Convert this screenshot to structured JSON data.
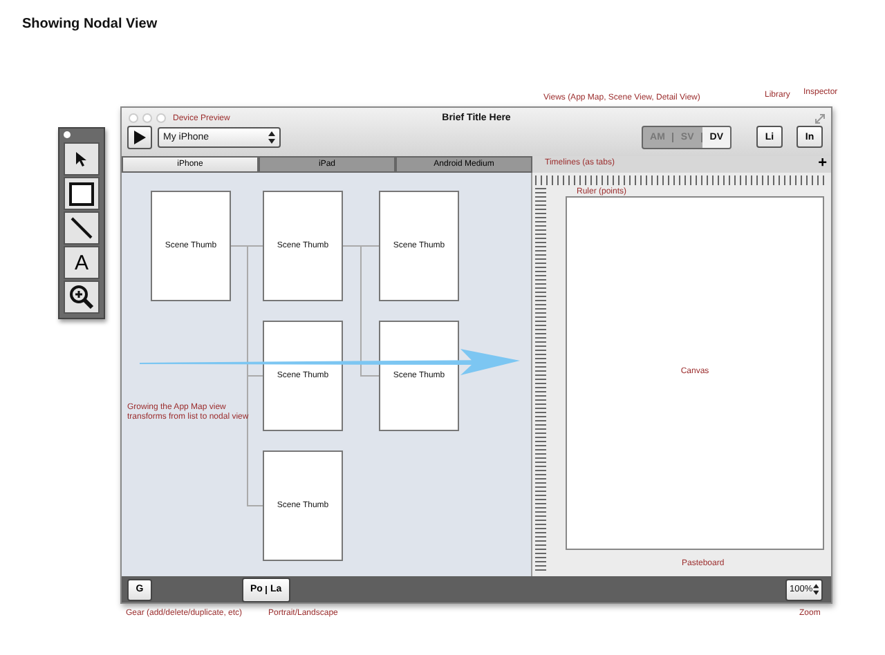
{
  "page_title": "Showing Nodal View",
  "annotations": {
    "device_preview": "Device Preview",
    "views": "Views (App Map, Scene View, Detail View)",
    "library": "Library",
    "inspector": "Inspector",
    "timelines": "Timelines (as tabs)",
    "ruler": "Ruler (points)",
    "canvas": "Canvas",
    "growing": "Growing the App Map view transforms from list to nodal view",
    "pasteboard": "Pasteboard",
    "gear": "Gear (add/delete/duplicate, etc)",
    "orientation": "Portrait/Landscape",
    "zoom": "Zoom"
  },
  "tool_palette": {
    "tools": [
      {
        "kind": "select"
      },
      {
        "kind": "rectangle"
      },
      {
        "kind": "line"
      },
      {
        "kind": "text",
        "label": "A"
      },
      {
        "kind": "zoom"
      }
    ]
  },
  "window": {
    "title": "Brief Title Here",
    "device_select": {
      "value": "My iPhone"
    },
    "view_modes": [
      {
        "label": "AM",
        "selected": false
      },
      {
        "label": "SV",
        "selected": false
      },
      {
        "label": "DV",
        "selected": true
      }
    ],
    "panel_buttons": [
      {
        "label": "Li"
      },
      {
        "label": "In"
      }
    ],
    "device_tabs": [
      {
        "label": "iPhone",
        "selected": true
      },
      {
        "label": "iPad",
        "selected": false
      },
      {
        "label": "Android Medium",
        "selected": false
      }
    ],
    "add_timeline": "+"
  },
  "scene_map": {
    "thumbs": [
      {
        "label": "Scene Thumb"
      },
      {
        "label": "Scene Thumb"
      },
      {
        "label": "Scene Thumb"
      },
      {
        "label": "Scene Thumb"
      },
      {
        "label": "Scene Thumb"
      },
      {
        "label": "Scene Thumb"
      }
    ]
  },
  "bottom_bar": {
    "gear_button": "G",
    "orientation": [
      {
        "label": "Po"
      },
      {
        "label": "La"
      }
    ],
    "zoom": "100%"
  }
}
